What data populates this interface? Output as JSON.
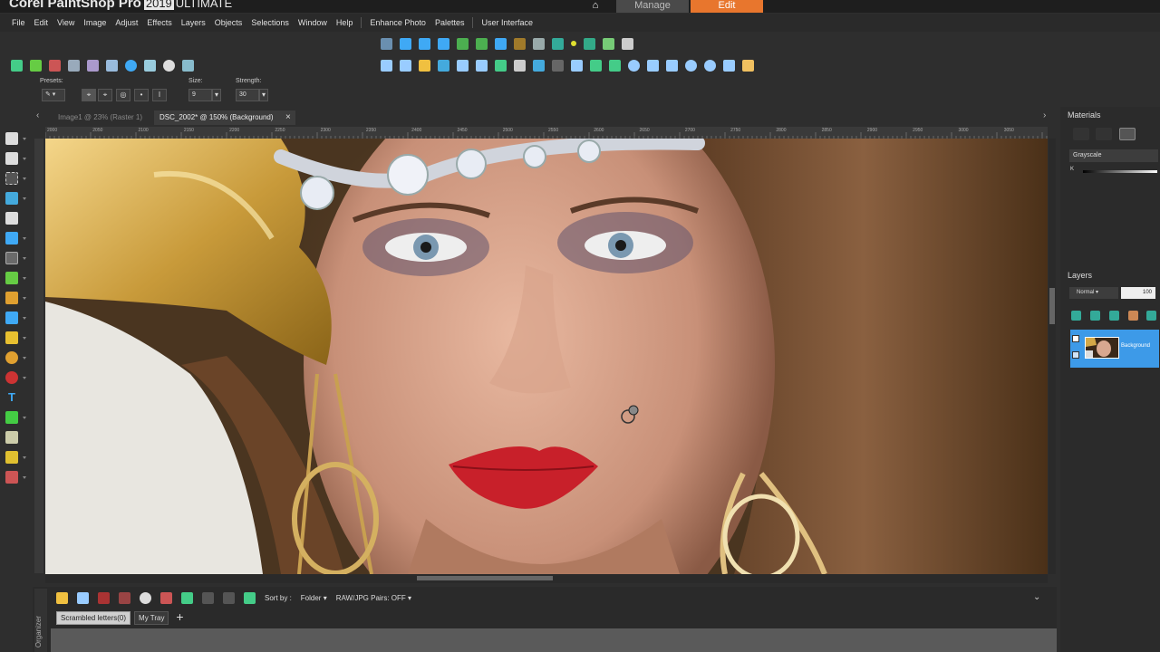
{
  "app": {
    "title_main": "Corel PaintShop Pro",
    "title_year": "2019",
    "title_edition": "ULTIMATE",
    "workspace_tabs": {
      "home": "⌂",
      "manage": "Manage",
      "edit": "Edit"
    }
  },
  "menu": {
    "items": [
      "File",
      "Edit",
      "View",
      "Image",
      "Adjust",
      "Effects",
      "Layers",
      "Objects",
      "Selections",
      "Window",
      "Help"
    ],
    "extra_items": [
      "Enhance Photo",
      "Palettes",
      "User Interface"
    ]
  },
  "tool_options": {
    "presets_label": "Presets:",
    "size_label": "Size:",
    "size_value": "9",
    "strength_label": "Strength:",
    "strength_value": "30"
  },
  "doc_tabs": [
    {
      "label": "Image1 @  23% (Raster 1)",
      "active": false
    },
    {
      "label": "DSC_2002* @ 150% (Background)",
      "active": true
    }
  ],
  "ruler": {
    "numbers": [
      "2000",
      "2050",
      "2100",
      "2150",
      "2200",
      "2250",
      "2300",
      "2350",
      "2400",
      "2450",
      "2500",
      "2550",
      "2600",
      "2650",
      "2700",
      "2750",
      "2800",
      "2850",
      "2900",
      "2950",
      "3000",
      "3050"
    ]
  },
  "organizer": {
    "sort_label": "Sort by :",
    "sort_value": "Folder",
    "raw_pairs": "RAW/JPG Pairs: OFF",
    "tabs": [
      "Scrambled letters(0)",
      "My Tray"
    ],
    "add_label": "+",
    "side_label": "Organizer"
  },
  "materials": {
    "title": "Materials",
    "mode": "Grayscale",
    "k_label": "K"
  },
  "layers": {
    "title": "Layers",
    "blend_mode": "Normal",
    "opacity": "100",
    "layer_name": "Background"
  },
  "colors": {
    "accent": "#e8762d",
    "selected_layer": "#3d9ae8"
  }
}
